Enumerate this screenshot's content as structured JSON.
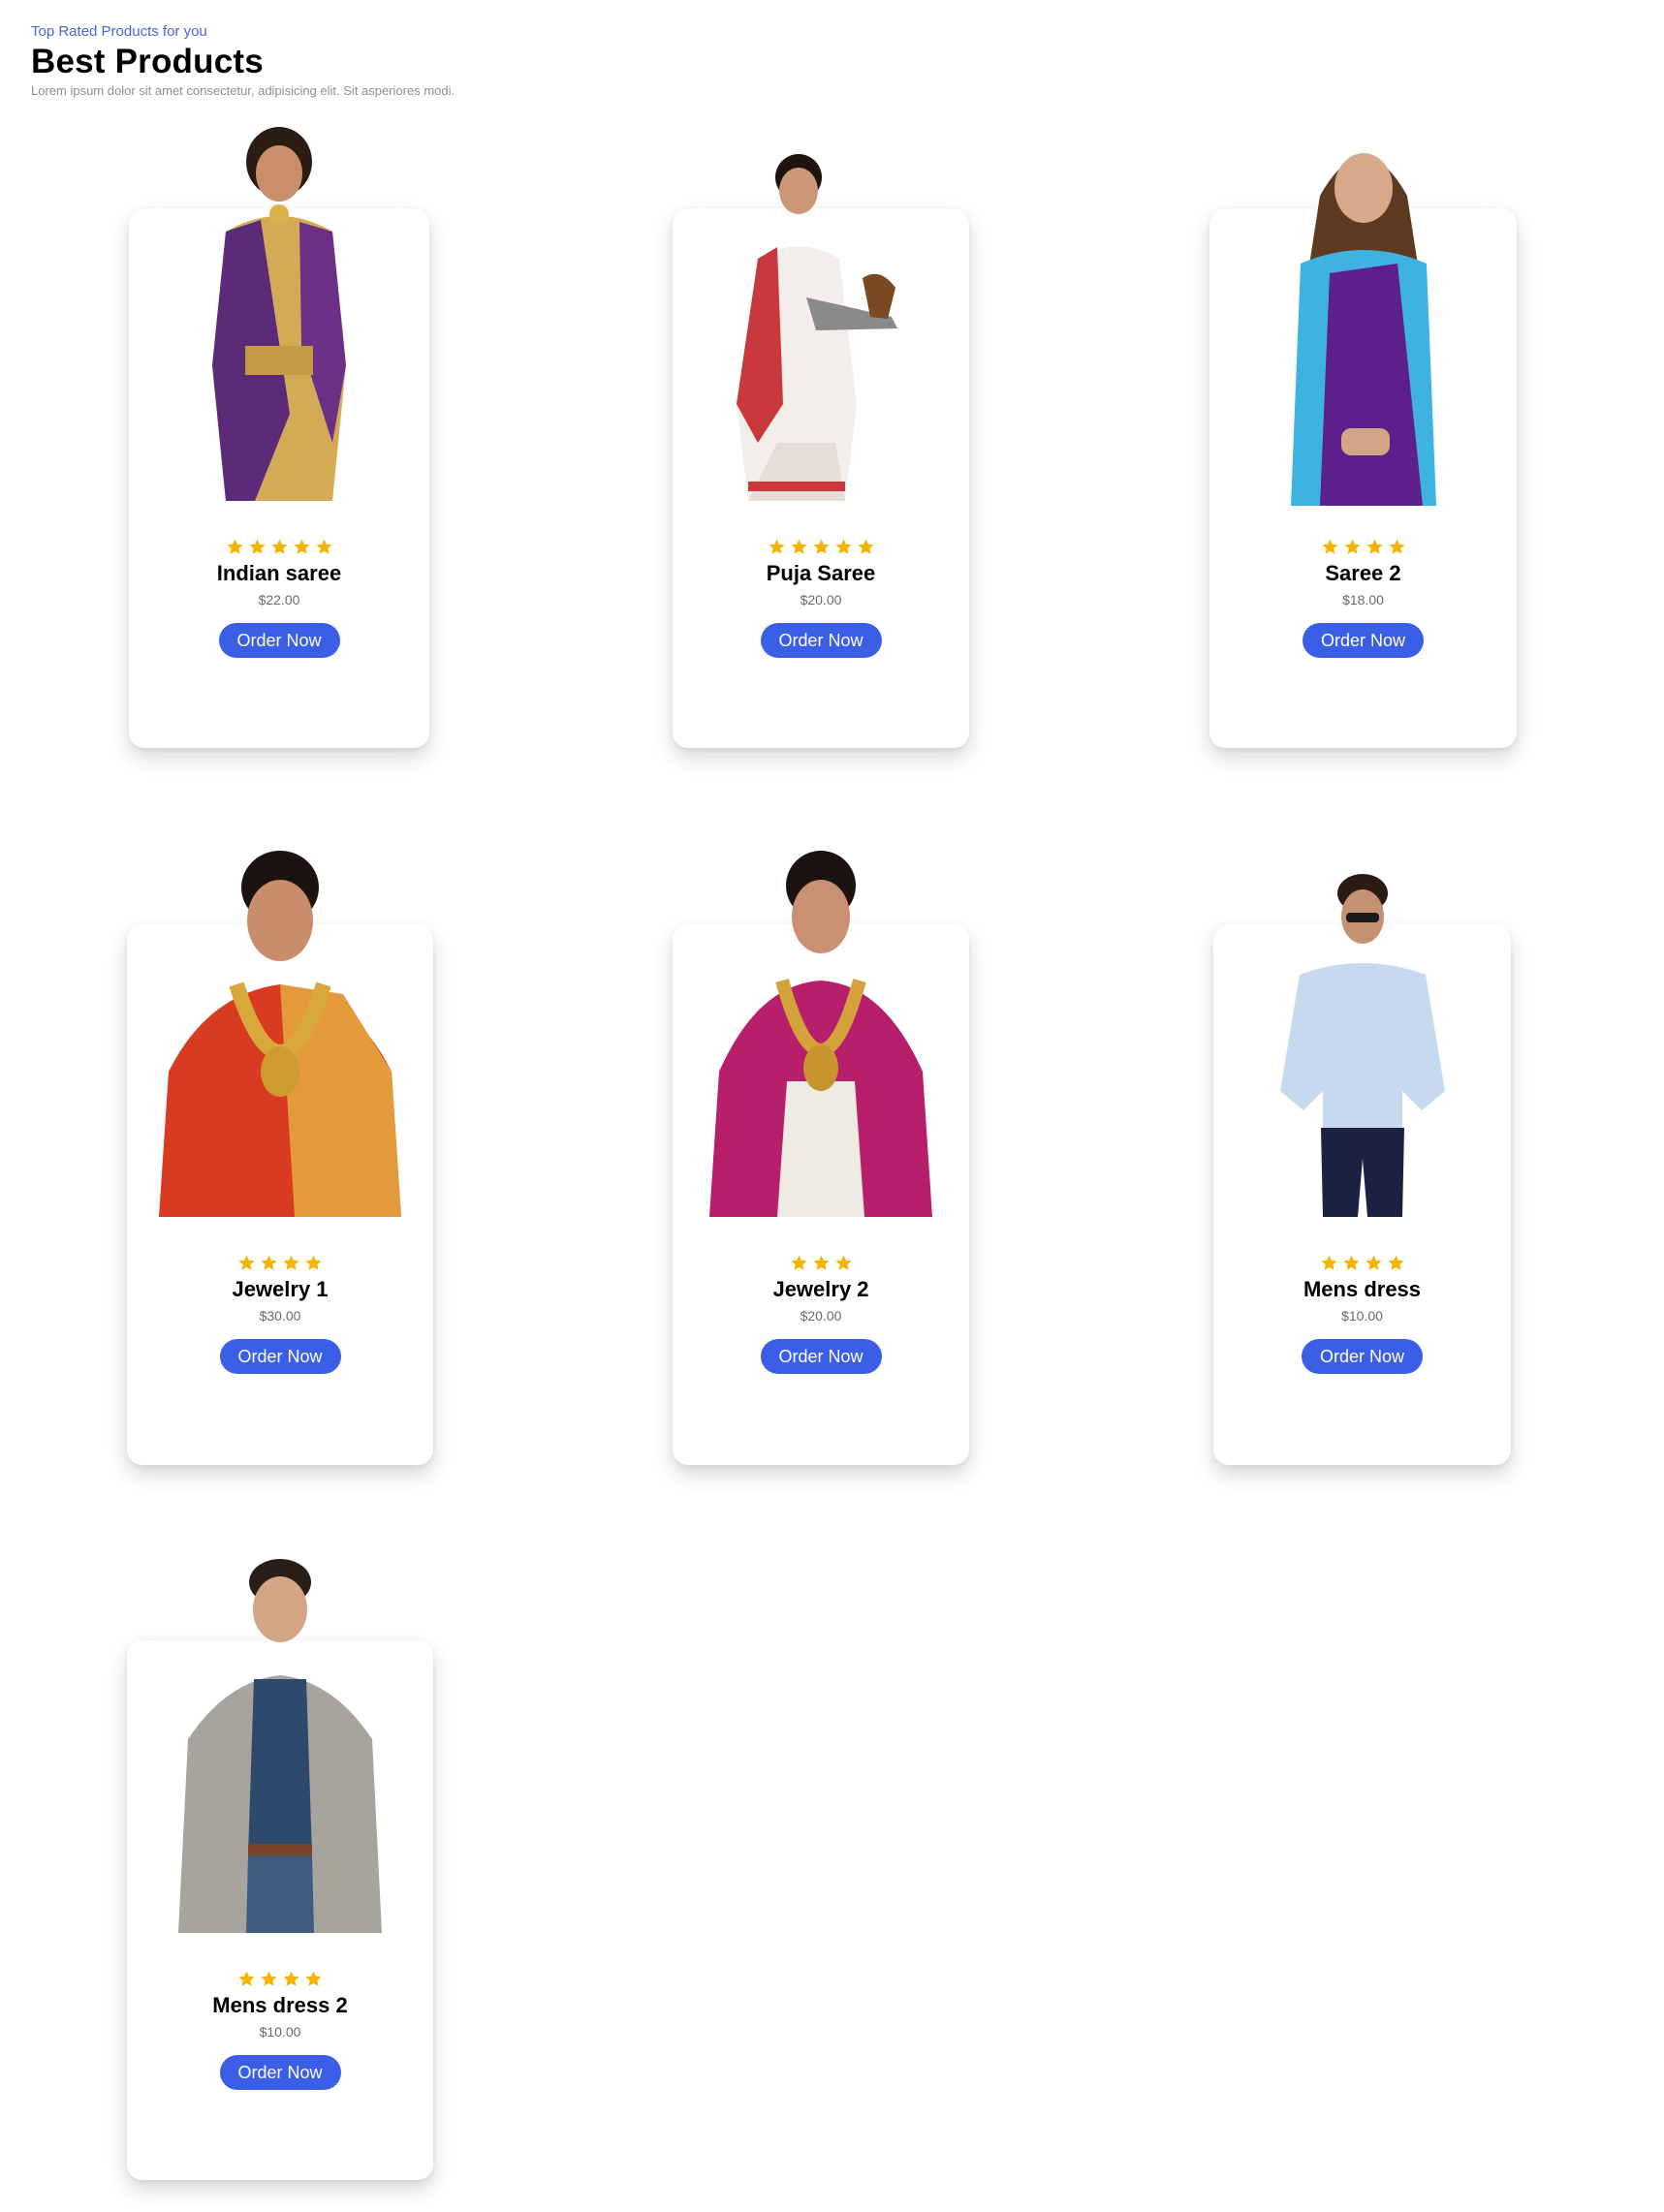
{
  "header": {
    "eyebrow": "Top Rated Products for you",
    "title": "Best Products",
    "subtitle": "Lorem ipsum dolor sit amet consectetur, adipisicing elit. Sit asperiores modi."
  },
  "accent_color": "#3b5ee6",
  "star_color": "#f4b400",
  "products": [
    {
      "name": "Indian saree",
      "price": "$22.00",
      "rating": 5,
      "button": "Order Now",
      "photo": "woman-purple-gold-saree"
    },
    {
      "name": "Puja Saree",
      "price": "$20.00",
      "rating": 5,
      "button": "Order Now",
      "photo": "woman-white-red-saree-puja-plate"
    },
    {
      "name": "Saree 2",
      "price": "$18.00",
      "rating": 4,
      "button": "Order Now",
      "photo": "woman-blue-purple-saree"
    },
    {
      "name": "Jewelry 1",
      "price": "$30.00",
      "rating": 4,
      "button": "Order Now",
      "photo": "bride-red-gold-jewelry"
    },
    {
      "name": "Jewelry 2",
      "price": "$20.00",
      "rating": 3,
      "button": "Order Now",
      "photo": "bride-magenta-gold-jewelry"
    },
    {
      "name": "Mens dress",
      "price": "$10.00",
      "rating": 4,
      "button": "Order Now",
      "photo": "man-light-blue-shirt-sunglasses"
    },
    {
      "name": "Mens dress 2",
      "price": "$10.00",
      "rating": 4,
      "button": "Order Now",
      "photo": "man-grey-jacket-navy-tee"
    }
  ]
}
